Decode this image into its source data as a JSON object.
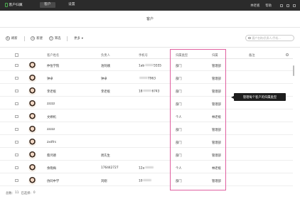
{
  "topbar": {
    "brand": "客户归属",
    "tabs": [
      "客户",
      "设置"
    ],
    "user": "林老板",
    "help": "帮助"
  },
  "page": {
    "title": "客户"
  },
  "toolbar": {
    "refresh": "刷新",
    "add": "新建",
    "filter": "筛选",
    "more": "更多",
    "search_placeholder": "客户名称/负责人/手机..."
  },
  "table": {
    "headers": [
      "客户姓名",
      "负责人",
      "手机号",
      "归属类型",
      "归属",
      "备注"
    ],
    "rows": [
      {
        "name": "仲恒学院",
        "owner": "池阿姨",
        "phone": "1ab",
        "phone_tail": "5555",
        "type": "部门",
        "belong": "管理部",
        "note": ""
      },
      {
        "name": "钟卓",
        "owner": "钟卓",
        "phone": "",
        "phone_tail": "7963",
        "type": "部门",
        "belong": "管理部",
        "note": ""
      },
      {
        "name": "李老板",
        "owner": "李老板",
        "phone": "18",
        "phone_tail": "6743",
        "type": "部门",
        "belong": "管理部",
        "note": ""
      },
      {
        "name": "zzzzz",
        "owner": "",
        "phone": "",
        "phone_tail": "",
        "type": "部门",
        "belong": "管理部",
        "note": ""
      },
      {
        "name": "文婷机",
        "owner": "",
        "phone": "",
        "phone_tail": "",
        "type": "个人",
        "belong": "林老板",
        "note": ""
      },
      {
        "name": "zzzzz",
        "owner": "",
        "phone": "",
        "phone_tail": "",
        "type": "部门",
        "belong": "管理部",
        "note": ""
      },
      {
        "name": "zxdfrs",
        "owner": "",
        "phone": "",
        "phone_tail": "",
        "type": "部门",
        "belong": "管理部",
        "note": ""
      },
      {
        "name": "蔡鸿德",
        "owner": "周先生",
        "phone": "",
        "phone_tail": "",
        "type": "部门",
        "belong": "管理部",
        "note": ""
      },
      {
        "name": "余晓梅",
        "owner": "176442727",
        "phone": "12a",
        "phone_tail": "",
        "type": "个人",
        "belong": "林老板",
        "note": ""
      },
      {
        "name": "仿同中学",
        "owner": "刘刚",
        "phone": "10",
        "phone_tail": "",
        "type": "部门",
        "belong": "管理部",
        "note": ""
      }
    ]
  },
  "callout": {
    "text": "管理每个客户的归属类型"
  },
  "footer": {
    "total_label": "总数:",
    "total": "11",
    "selected_label": "已选择:",
    "selected": "0"
  },
  "colors": {
    "highlight": "#e060a0",
    "topbar": "#2b2b2b"
  }
}
